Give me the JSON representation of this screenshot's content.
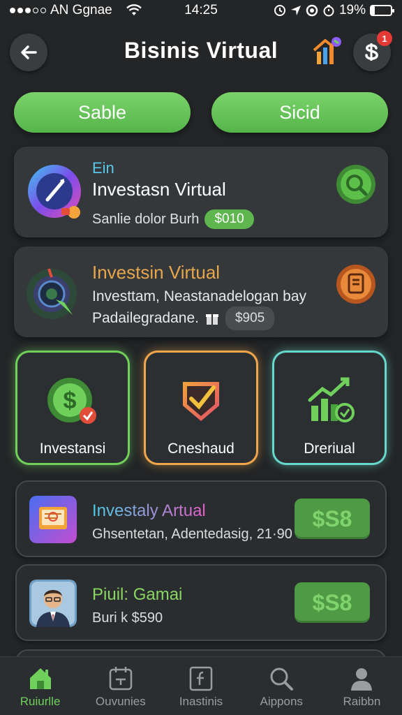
{
  "status_bar": {
    "carrier": "AN Ggnae",
    "time": "14:25",
    "battery": "19%",
    "battery_level": 0.19
  },
  "header": {
    "title": "Bisinis Virtual",
    "badge_count": "1"
  },
  "top_pills": [
    {
      "label": "Sable"
    },
    {
      "label": "Sicid"
    }
  ],
  "card1": {
    "small_title": "Ein",
    "title": "Investasn Virtual",
    "sub": "Sanlie dolor Burh",
    "price": "$010"
  },
  "card2": {
    "title": "Investsin Virtual",
    "body_line1": "Investtam, Neastanadelogan bay",
    "body_line2": "Padailegradane.",
    "price": "$905"
  },
  "tiles": [
    {
      "label": "Investansi"
    },
    {
      "label": "Cneshaud"
    },
    {
      "label": "Dreriual"
    }
  ],
  "list": [
    {
      "title": "Investaly Artual",
      "sub": "Ghsentetan, Adentedasig, 21·90",
      "price": "$S8"
    },
    {
      "title": "Piuil: Gamai",
      "sub": "Buri k $590",
      "price": "$S8"
    }
  ],
  "nav": [
    {
      "label": "Ruiurlle"
    },
    {
      "label": "Ouvunies"
    },
    {
      "label": "Inastinis"
    },
    {
      "label": "Aippons"
    },
    {
      "label": "Raibbn"
    }
  ],
  "colors": {
    "accent_green": "#6fd05b",
    "accent_orange": "#f0a64a",
    "accent_teal": "#66d8cc",
    "background": "#232527"
  }
}
